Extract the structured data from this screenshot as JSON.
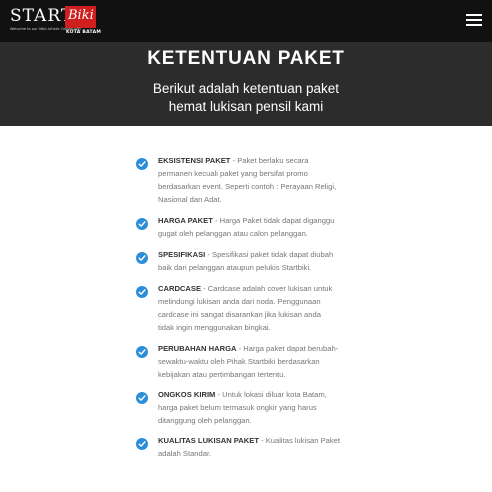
{
  "header": {
    "logo_start": "START",
    "logo_biki": "Biki",
    "logo_tagline": "Welcome to our little Artistic Community",
    "logo_city": "KOTA BATAM",
    "menu_icon": "hamburger-menu-icon"
  },
  "hero": {
    "title": "KETENTUAN PAKET",
    "subtitle_line1": "Berikut adalah ketentuan paket",
    "subtitle_line2": "hemat lukisan pensil kami"
  },
  "accent_color": "#2a8fd8",
  "terms": [
    {
      "title": "EKSISTENSI PAKET",
      "sep": " - ",
      "lines": [
        "Paket berlaku secara",
        "permanen kecuali paket yang bersifat promo",
        "berdasarkan event. Seperti contoh : Perayaan Religi,",
        "Nasional dan Adat."
      ]
    },
    {
      "title": "HARGA PAKET",
      "sep": " - ",
      "lines": [
        "Harga Paket tidak dapat diganggu",
        "gugat oleh pelanggan atau calon pelanggan."
      ]
    },
    {
      "title": "SPESIFIKASI",
      "sep": " - ",
      "lines": [
        "Spesifikasi paket tidak dapat diubah",
        "baik dari pelanggan ataupun pelukis Startbiki."
      ]
    },
    {
      "title": "CARDCASE",
      "sep": " - ",
      "lines": [
        "Cardcase adalah cover lukisan untuk",
        "melindungi lukisan anda dari noda. Penggunaan",
        "cardcase ini sangat disarankan jika lukisan anda",
        "tidak ingin menggunakan bingkai."
      ]
    },
    {
      "title": "PERUBAHAN HARGA",
      "sep": " - ",
      "lines": [
        "Harga paket dapat berubah-",
        "sewaktu-waktu oleh Pihak Startbiki berdasarkan",
        "kebijakan atau pertimbangan tertentu."
      ]
    },
    {
      "title": "ONGKOS KIRIM",
      "sep": " - ",
      "lines": [
        "Untuk lokasi diluar kota Batam,",
        "harga paket belum termasuk ongkir yang harus",
        "ditanggung oleh pelanggan."
      ]
    },
    {
      "title": "KUALITAS LUKISAN PAKET",
      "sep": " - ",
      "lines": [
        "Kualitas lukisan Paket",
        "adalah Standar."
      ]
    }
  ]
}
